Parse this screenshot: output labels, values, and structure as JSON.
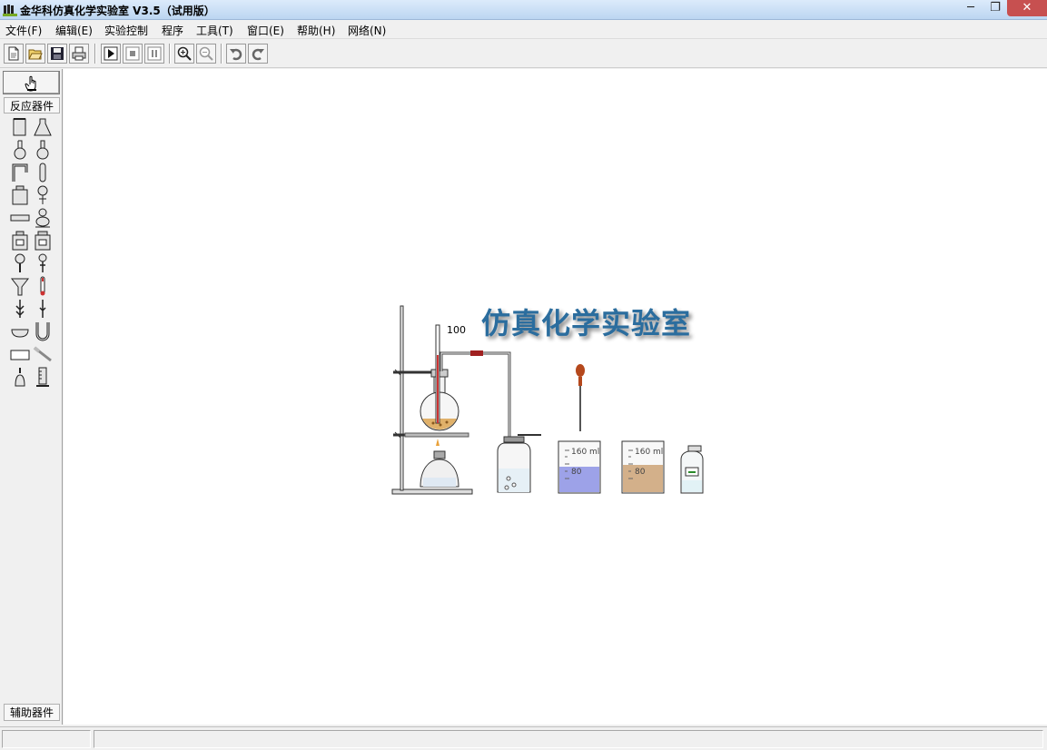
{
  "window": {
    "title": "金华科仿真化学实验室 V3.5（试用版）",
    "minimize": "─",
    "maximize": "❐",
    "close": "✕"
  },
  "menu": [
    {
      "label": "文件(F)"
    },
    {
      "label": "编辑(E)"
    },
    {
      "label": "实验控制"
    },
    {
      "label": "程序"
    },
    {
      "label": "工具(T)"
    },
    {
      "label": "窗口(E)"
    },
    {
      "label": "帮助(H)"
    },
    {
      "label": "网络(N)"
    }
  ],
  "toolbar": {
    "buttons": [
      "new-file-icon",
      "open-folder-icon",
      "save-disk-icon",
      "print-icon",
      "play-icon",
      "stop-icon",
      "pause-icon",
      "zoom-in-icon",
      "zoom-out-icon",
      "undo-icon",
      "redo-icon"
    ]
  },
  "sidebar": {
    "tab_top": "反应器件",
    "tab_bottom": "辅助器件",
    "tools": [
      "beaker-tool",
      "conical-flask-tool",
      "round-flask-tool",
      "volumetric-flask-tool",
      "bent-tube-tool",
      "test-tube-tool",
      "jar-tool",
      "separatory-funnel-tool",
      "straight-tube-tool",
      "kipp-generator-tool",
      "reagent-bottle-tool",
      "wide-bottle-tool",
      "dropper-tool",
      "dropper-pipette-tool",
      "funnel-tool",
      "thermometer-tool",
      "gas-tube-tool",
      "long-needle-tool",
      "evaporating-dish-tool",
      "u-tube-tool",
      "trough-tool",
      "spatula-tool",
      "alcohol-lamp-tool",
      "graduated-cylinder-tool"
    ]
  },
  "canvas": {
    "brand": "仿真化学实验室",
    "thermometer_reading": "100",
    "beaker1_top": "160 ml",
    "beaker1_mid": "80",
    "beaker2_top": "160 ml",
    "beaker2_mid": "80"
  },
  "colors": {
    "titlebar": "#bcd6f1",
    "brand_text": "#2b6d9e",
    "close_button": "#c75050"
  }
}
